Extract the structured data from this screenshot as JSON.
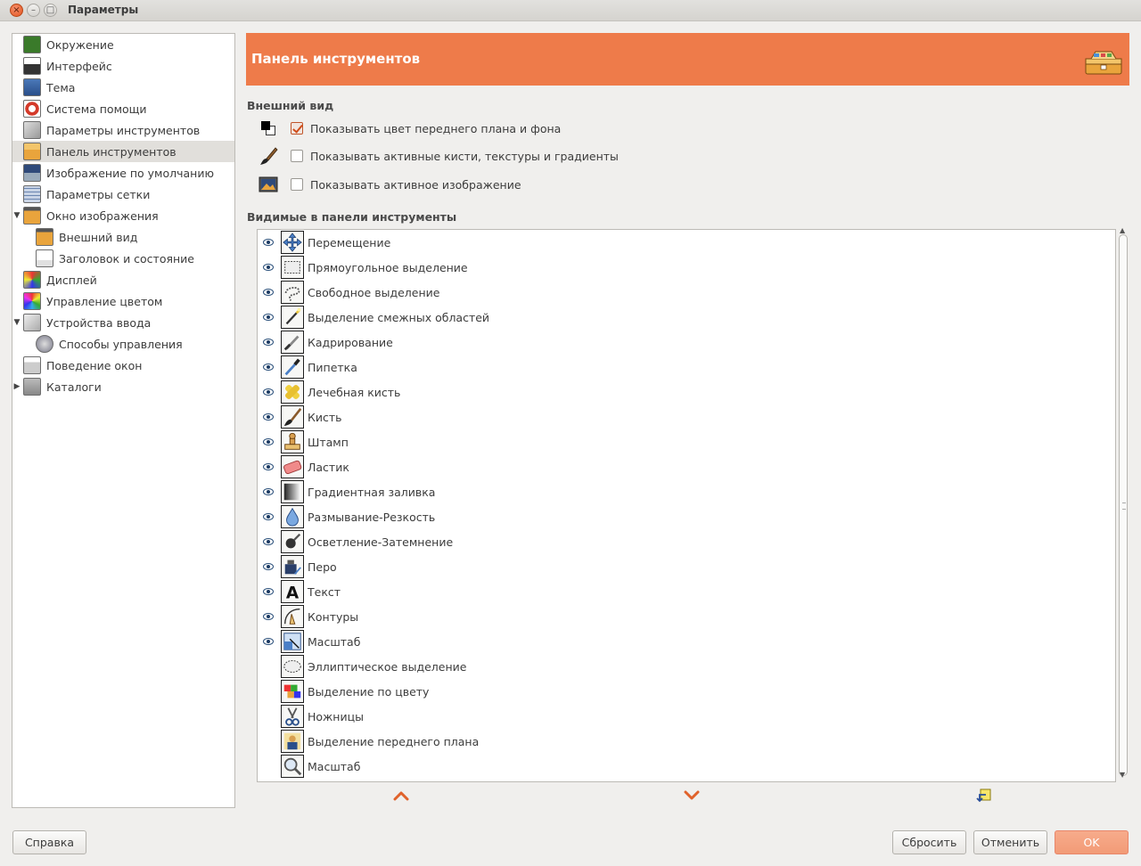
{
  "window": {
    "title": "Параметры"
  },
  "sidebar": {
    "items": [
      {
        "label": "Окружение",
        "icon": "environment-icon",
        "indent": 0,
        "expander": ""
      },
      {
        "label": "Интерфейс",
        "icon": "interface-icon",
        "indent": 0,
        "expander": ""
      },
      {
        "label": "Тема",
        "icon": "theme-icon",
        "indent": 0,
        "expander": ""
      },
      {
        "label": "Система помощи",
        "icon": "help-system-icon",
        "indent": 0,
        "expander": ""
      },
      {
        "label": "Параметры инструментов",
        "icon": "tool-options-icon",
        "indent": 0,
        "expander": ""
      },
      {
        "label": "Панель инструментов",
        "icon": "toolbox-icon",
        "indent": 0,
        "expander": "",
        "selected": true
      },
      {
        "label": "Изображение по умолчанию",
        "icon": "default-image-icon",
        "indent": 0,
        "expander": ""
      },
      {
        "label": "Параметры сетки",
        "icon": "grid-icon",
        "indent": 0,
        "expander": ""
      },
      {
        "label": "Окно изображения",
        "icon": "image-window-icon",
        "indent": 0,
        "expander": "▼"
      },
      {
        "label": "Внешний вид",
        "icon": "appearance-icon",
        "indent": 1,
        "expander": ""
      },
      {
        "label": "Заголовок и состояние",
        "icon": "title-status-icon",
        "indent": 1,
        "expander": ""
      },
      {
        "label": "Дисплей",
        "icon": "display-icon",
        "indent": 0,
        "expander": ""
      },
      {
        "label": "Управление цветом",
        "icon": "color-management-icon",
        "indent": 0,
        "expander": ""
      },
      {
        "label": "Устройства ввода",
        "icon": "input-devices-icon",
        "indent": 0,
        "expander": "▼"
      },
      {
        "label": "Способы управления",
        "icon": "input-controllers-icon",
        "indent": 1,
        "expander": ""
      },
      {
        "label": "Поведение окон",
        "icon": "window-management-icon",
        "indent": 0,
        "expander": ""
      },
      {
        "label": "Каталоги",
        "icon": "folders-icon",
        "indent": 0,
        "expander": "▶"
      }
    ]
  },
  "header": {
    "title": "Панель инструментов",
    "icon": "toolbox-icon"
  },
  "appearance": {
    "section_label": "Внешний вид",
    "options": [
      {
        "label": "Показывать цвет переднего плана и фона",
        "checked": true,
        "icon": "fg-bg-colors-icon"
      },
      {
        "label": "Показывать активные кисти, текстуры и градиенты",
        "checked": false,
        "icon": "brush-icon"
      },
      {
        "label": "Показывать активное изображение",
        "checked": false,
        "icon": "active-image-icon"
      }
    ]
  },
  "tools": {
    "section_label": "Видимые в панели инструменты",
    "items": [
      {
        "label": "Перемещение",
        "visible": true,
        "icon": "move-tool-icon"
      },
      {
        "label": "Прямоугольное выделение",
        "visible": true,
        "icon": "rect-select-icon"
      },
      {
        "label": "Свободное выделение",
        "visible": true,
        "icon": "free-select-icon"
      },
      {
        "label": "Выделение смежных областей",
        "visible": true,
        "icon": "fuzzy-select-icon"
      },
      {
        "label": "Кадрирование",
        "visible": true,
        "icon": "crop-icon"
      },
      {
        "label": "Пипетка",
        "visible": true,
        "icon": "color-picker-icon"
      },
      {
        "label": "Лечебная кисть",
        "visible": true,
        "icon": "heal-icon"
      },
      {
        "label": "Кисть",
        "visible": true,
        "icon": "paintbrush-icon"
      },
      {
        "label": "Штамп",
        "visible": true,
        "icon": "clone-icon"
      },
      {
        "label": "Ластик",
        "visible": true,
        "icon": "eraser-icon"
      },
      {
        "label": "Градиентная заливка",
        "visible": true,
        "icon": "gradient-icon"
      },
      {
        "label": "Размывание-Резкость",
        "visible": true,
        "icon": "blur-sharpen-icon"
      },
      {
        "label": "Осветление-Затемнение",
        "visible": true,
        "icon": "dodge-burn-icon"
      },
      {
        "label": "Перо",
        "visible": true,
        "icon": "ink-icon"
      },
      {
        "label": "Текст",
        "visible": true,
        "icon": "text-tool-icon"
      },
      {
        "label": "Контуры",
        "visible": true,
        "icon": "paths-icon"
      },
      {
        "label": "Масштаб",
        "visible": true,
        "icon": "scale-icon"
      },
      {
        "label": "Эллиптическое выделение",
        "visible": false,
        "icon": "ellipse-select-icon"
      },
      {
        "label": "Выделение по цвету",
        "visible": false,
        "icon": "select-by-color-icon"
      },
      {
        "label": "Ножницы",
        "visible": false,
        "icon": "scissors-icon"
      },
      {
        "label": "Выделение переднего плана",
        "visible": false,
        "icon": "foreground-select-icon"
      },
      {
        "label": "Масштаб",
        "visible": false,
        "icon": "zoom-icon"
      }
    ]
  },
  "buttons": {
    "help": "Справка",
    "reset": "Сбросить",
    "cancel": "Отменить",
    "ok": "OK"
  },
  "colors": {
    "accent": "#ee7b4a",
    "ok_button": "#f29b77",
    "selected_row": "#e1dfdb"
  }
}
